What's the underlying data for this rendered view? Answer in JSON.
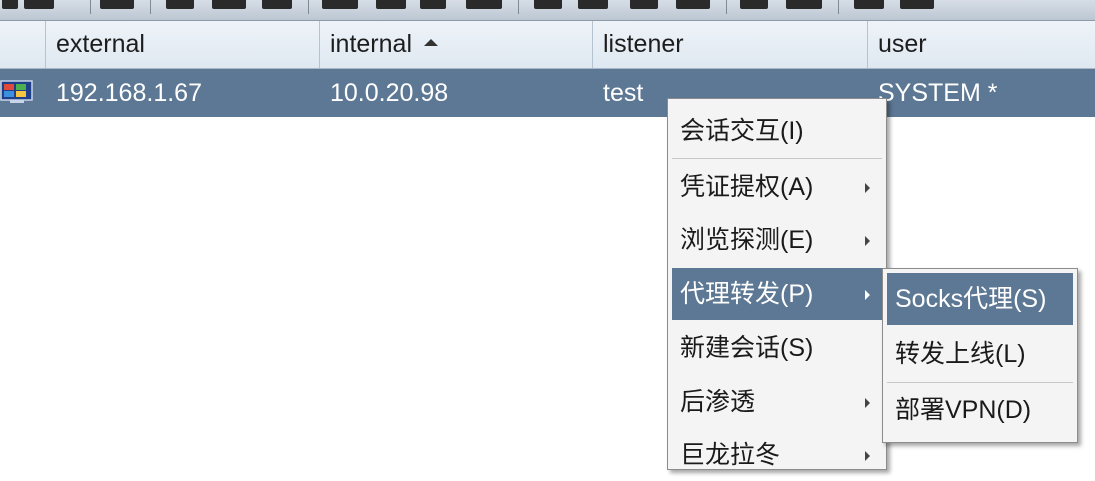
{
  "table": {
    "columns": [
      {
        "label": "external"
      },
      {
        "label": "internal",
        "sorted": "ascending"
      },
      {
        "label": "listener"
      },
      {
        "label": "user"
      }
    ],
    "rows": [
      {
        "external": "192.168.1.67",
        "internal": "10.0.20.98",
        "listener": "test",
        "user": "SYSTEM *",
        "selected": true
      }
    ]
  },
  "context_menu": {
    "items": [
      {
        "label": "会话交互(I)",
        "submenu": false
      },
      {
        "label": "凭证提权(A)",
        "submenu": true
      },
      {
        "label": "浏览探测(E)",
        "submenu": true
      },
      {
        "label": "代理转发(P)",
        "submenu": true,
        "active": true
      },
      {
        "label": "新建会话(S)",
        "submenu": false
      },
      {
        "label": "后渗透",
        "submenu": true
      },
      {
        "label": "巨龙拉冬",
        "submenu": true
      }
    ]
  },
  "submenu": {
    "items": [
      {
        "label": "Socks代理(S)",
        "active": true
      },
      {
        "label": "转发上线(L)"
      },
      {
        "label": "部署VPN(D)"
      }
    ]
  },
  "colors": {
    "selection": "#5d7894",
    "header_bg": "#e6edf4",
    "menu_bg": "#f4f4f4"
  }
}
